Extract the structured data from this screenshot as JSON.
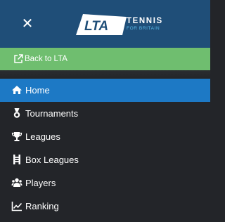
{
  "header": {
    "close_icon": "close-icon",
    "logo": {
      "mark_text": "LTA",
      "title": "TENNIS",
      "subtitle": "FOR BRITAIN"
    }
  },
  "back_link": {
    "icon": "external-link-icon",
    "label": "Back to LTA"
  },
  "nav": {
    "items": [
      {
        "label": "Home",
        "icon": "home-icon",
        "active": true
      },
      {
        "label": "Tournaments",
        "icon": "medal-icon",
        "active": false
      },
      {
        "label": "Leagues",
        "icon": "trophy-icon",
        "active": false
      },
      {
        "label": "Box Leagues",
        "icon": "box-leagues-icon",
        "active": false
      },
      {
        "label": "Players",
        "icon": "users-icon",
        "active": false
      },
      {
        "label": "Ranking",
        "icon": "line-chart-icon",
        "active": false
      }
    ]
  },
  "colors": {
    "header_bg": "#1f4e78",
    "back_bar_bg": "#6fbe6f",
    "menu_bg": "#232529",
    "active_bg": "#1d79c5",
    "text": "#ffffff",
    "logo_accent": "#58b8e8"
  }
}
